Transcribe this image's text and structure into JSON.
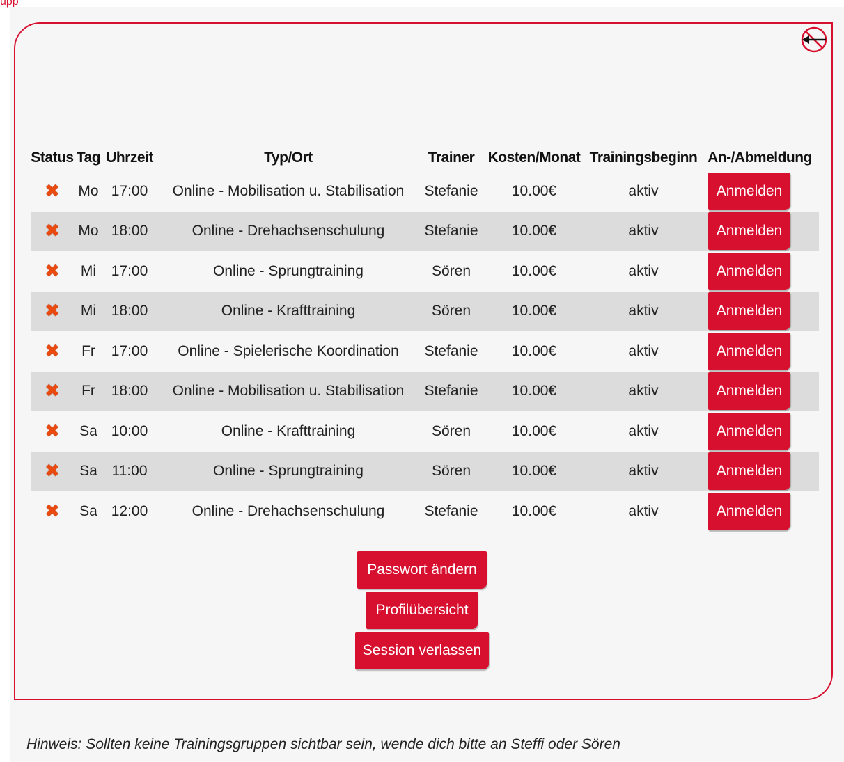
{
  "header": {
    "partial_text": "upp"
  },
  "colors": {
    "accent": "#d8102f",
    "row_alt": "#dcdcdc",
    "panel_bg": "#f6f6f6",
    "status_x": "#e84a10"
  },
  "icons": {
    "back": "back-arrow-icon",
    "status": "x-mark-icon"
  },
  "table": {
    "headers": {
      "status": "Status",
      "day": "Tag",
      "time": "Uhrzeit",
      "type": "Typ/Ort",
      "trainer": "Trainer",
      "cost": "Kosten/Monat",
      "start": "Trainingsbeginn",
      "signup": "An-/Abmeldung"
    },
    "rows": [
      {
        "status": "✖",
        "day": "Mo",
        "time": "17:00",
        "type": "Online - Mobilisation u. Stabilisation",
        "trainer": "Stefanie",
        "cost": "10.00€",
        "start": "aktiv",
        "action": "Anmelden"
      },
      {
        "status": "✖",
        "day": "Mo",
        "time": "18:00",
        "type": "Online - Drehachsenschulung",
        "trainer": "Stefanie",
        "cost": "10.00€",
        "start": "aktiv",
        "action": "Anmelden"
      },
      {
        "status": "✖",
        "day": "Mi",
        "time": "17:00",
        "type": "Online - Sprungtraining",
        "trainer": "Sören",
        "cost": "10.00€",
        "start": "aktiv",
        "action": "Anmelden"
      },
      {
        "status": "✖",
        "day": "Mi",
        "time": "18:00",
        "type": "Online - Krafttraining",
        "trainer": "Sören",
        "cost": "10.00€",
        "start": "aktiv",
        "action": "Anmelden"
      },
      {
        "status": "✖",
        "day": "Fr",
        "time": "17:00",
        "type": "Online - Spielerische Koordination",
        "trainer": "Stefanie",
        "cost": "10.00€",
        "start": "aktiv",
        "action": "Anmelden"
      },
      {
        "status": "✖",
        "day": "Fr",
        "time": "18:00",
        "type": "Online - Mobilisation u. Stabilisation",
        "trainer": "Stefanie",
        "cost": "10.00€",
        "start": "aktiv",
        "action": "Anmelden"
      },
      {
        "status": "✖",
        "day": "Sa",
        "time": "10:00",
        "type": "Online - Krafttraining",
        "trainer": "Sören",
        "cost": "10.00€",
        "start": "aktiv",
        "action": "Anmelden"
      },
      {
        "status": "✖",
        "day": "Sa",
        "time": "11:00",
        "type": "Online - Sprungtraining",
        "trainer": "Sören",
        "cost": "10.00€",
        "start": "aktiv",
        "action": "Anmelden"
      },
      {
        "status": "✖",
        "day": "Sa",
        "time": "12:00",
        "type": "Online - Drehachsenschulung",
        "trainer": "Stefanie",
        "cost": "10.00€",
        "start": "aktiv",
        "action": "Anmelden"
      }
    ]
  },
  "actions": {
    "change_password": "Passwort ändern",
    "profile_overview": "Profilübersicht",
    "leave_session": "Session verlassen"
  },
  "hint": "Hinweis: Sollten keine Trainingsgruppen sichtbar sein, wende dich bitte an Steffi oder Sören"
}
